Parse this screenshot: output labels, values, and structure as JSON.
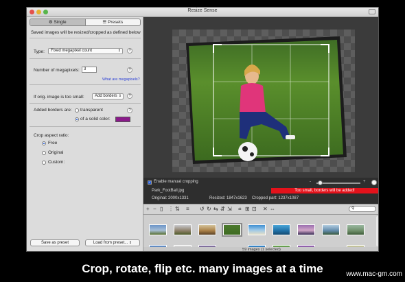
{
  "window": {
    "title": "Resize Sense"
  },
  "tabs": [
    {
      "label": "Single",
      "icon": "gear-icon"
    },
    {
      "label": "Presets",
      "icon": "list-icon"
    }
  ],
  "sidebar": {
    "intro": "Saved images will be resized/cropped as defined below",
    "type_label": "Type:",
    "type_value": "Fixed megapixel count",
    "megapixels_label": "Number of megapixels:",
    "megapixels_value": "3",
    "megapixels_link": "What are megapixels?",
    "too_small_label": "If orig. image is too small:",
    "too_small_value": "Add borders",
    "borders_label": "Added borders are:",
    "border_transparent": "transparent",
    "border_solid": "of a solid color:",
    "aspect_label": "Crop aspect ratio:",
    "aspect_options": [
      "Free",
      "Original",
      "Custom:"
    ],
    "save_preset": "Save as preset",
    "load_preset": "Load from preset...",
    "help": "?",
    "swatch_color": "#8a1a8a"
  },
  "controls": {
    "manual_crop": "Enable manual cropping",
    "filename": "Park_FootBall.jpg",
    "original": "Original: 2000x1331",
    "resized": "Resized: 1847x1623",
    "cropped": "Cropped part: 1237x1087",
    "warning": "Too small, borders will be added!",
    "zoom_minus": "-",
    "zoom_plus": "+"
  },
  "status": {
    "text": "59 images (1 selected)"
  },
  "caption": "Crop, rotate, flip etc. many images at a time",
  "watermark": "www.mac-gm.com"
}
